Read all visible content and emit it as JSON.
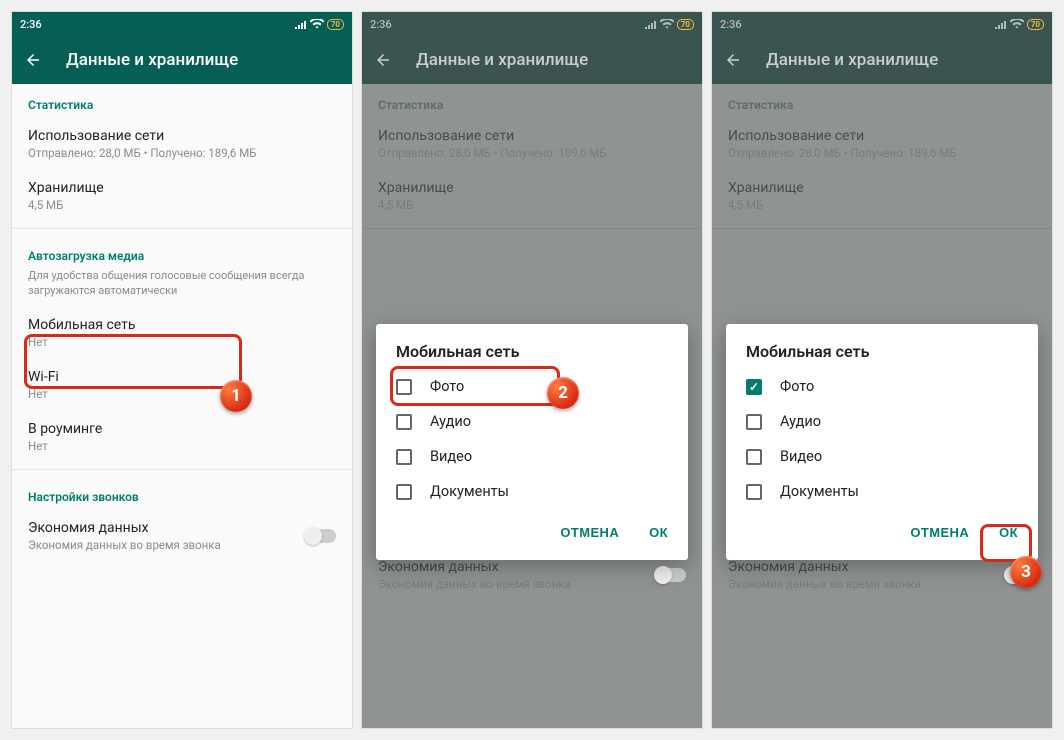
{
  "status": {
    "time": "2:36",
    "battery": "70"
  },
  "toolbar": {
    "title": "Данные и хранилище"
  },
  "sections": {
    "stats": "Статистика",
    "network_usage_title": "Использование сети",
    "network_usage_sub": "Отправлено: 28,0 МБ • Получено: 189,6 МБ",
    "storage_title": "Хранилище",
    "storage_sub": "4,5 МБ",
    "autodl": "Автозагрузка медиа",
    "autodl_sub": "Для удобства общения голосовые сообщения всегда загружаются автоматически",
    "mobile_title": "Мобильная сеть",
    "mobile_sub": "Нет",
    "wifi_title": "Wi-Fi",
    "wifi_sub": "Нет",
    "roaming_title": "В роуминге",
    "roaming_sub": "Нет",
    "calls": "Настройки звонков",
    "saver_title": "Экономия данных",
    "saver_sub": "Экономия данных во время звонка"
  },
  "dialog": {
    "title": "Мобильная сеть",
    "items": [
      "Фото",
      "Аудио",
      "Видео",
      "Документы"
    ],
    "cancel": "ОТМЕНА",
    "ok": "ОК"
  },
  "badges": {
    "one": "1",
    "two": "2",
    "three": "3"
  }
}
